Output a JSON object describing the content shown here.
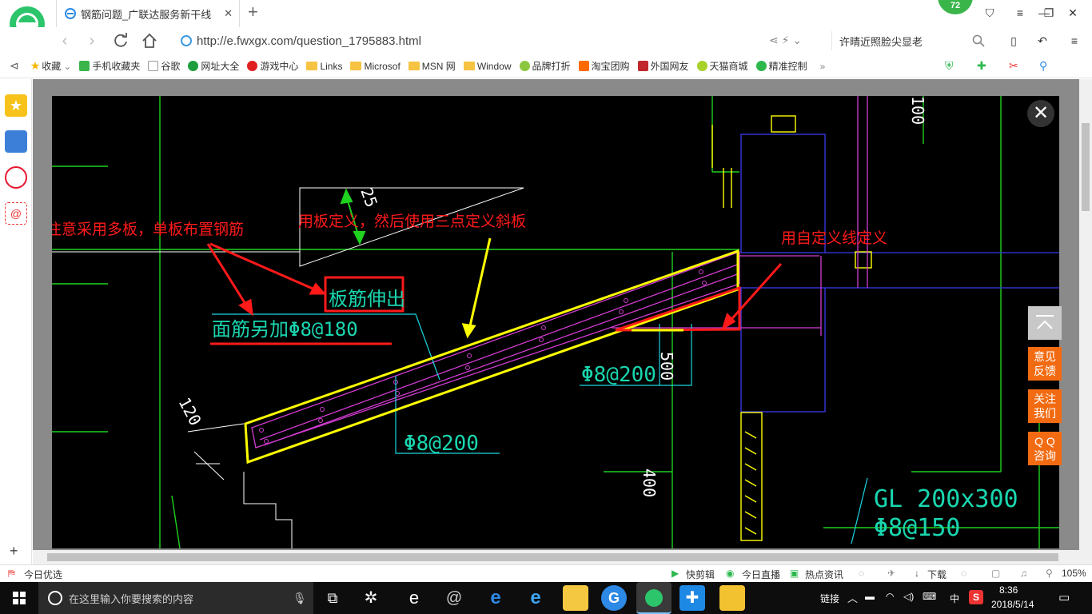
{
  "browser": {
    "tab_title": "钢筋问题_广联达服务新干线",
    "avatar_badge": "72",
    "url": "http://e.fwxgx.com/question_1795883.html",
    "search_text": "许晴近照脸尖显老"
  },
  "bookmarks": [
    {
      "label": "收藏",
      "icon": "star-icon"
    },
    {
      "label": "手机收藏夹",
      "icon": "phone-icon"
    },
    {
      "label": "谷歌",
      "icon": "page-icon"
    },
    {
      "label": "网址大全",
      "icon": "globe-icon"
    },
    {
      "label": "游戏中心",
      "icon": "game-icon"
    },
    {
      "label": "Links",
      "icon": "folder-icon"
    },
    {
      "label": "Microsof",
      "icon": "folder-icon"
    },
    {
      "label": "MSN 网",
      "icon": "folder-icon"
    },
    {
      "label": "Window",
      "icon": "folder-icon"
    },
    {
      "label": "品牌打折",
      "icon": "leaf-icon"
    },
    {
      "label": "淘宝团购",
      "icon": "taobao-icon"
    },
    {
      "label": "外国网友",
      "icon": "bookmark-icon"
    },
    {
      "label": "天猫商城",
      "icon": "leaf-icon"
    },
    {
      "label": "精准控制",
      "icon": "chat-icon"
    }
  ],
  "annotations": {
    "note_multi_board": "注意采用多板，单板布置钢筋",
    "note_three_point": "用板定义，然后使用三点定义斜板",
    "note_custom_line": "用自定义线定义"
  },
  "drawing_labels": {
    "board_extend": "板筋伸出",
    "top_bar_add": "面筋另加Φ8@180",
    "rebar_200_a": "Φ8@200",
    "rebar_200_b": "Φ8@200",
    "gl_size": "GL 200x300",
    "rebar_150": "Φ8@150",
    "dim_120": "120",
    "dim_500": "500",
    "dim_400": "400",
    "dim_100": "100",
    "dim_25": "25"
  },
  "float_buttons": {
    "feedback": "意见\n反馈",
    "follow": "关注\n我们",
    "qq": "Q Q\n咨询"
  },
  "statusbar": {
    "today": "今日优选",
    "clip": "快剪辑",
    "live": "今日直播",
    "news": "热点资讯",
    "download": "下载",
    "zoom": "105%"
  },
  "taskbar": {
    "search_placeholder": "在这里输入你要搜索的内容",
    "link_label": "链接",
    "ime": "中",
    "time": "8:36",
    "date": "2018/5/14"
  },
  "colors": {
    "annotation": "#ff1a1a",
    "float_button": "#f26b12",
    "cad_bg": "#000000",
    "taskbar": "#0d0d0d"
  }
}
